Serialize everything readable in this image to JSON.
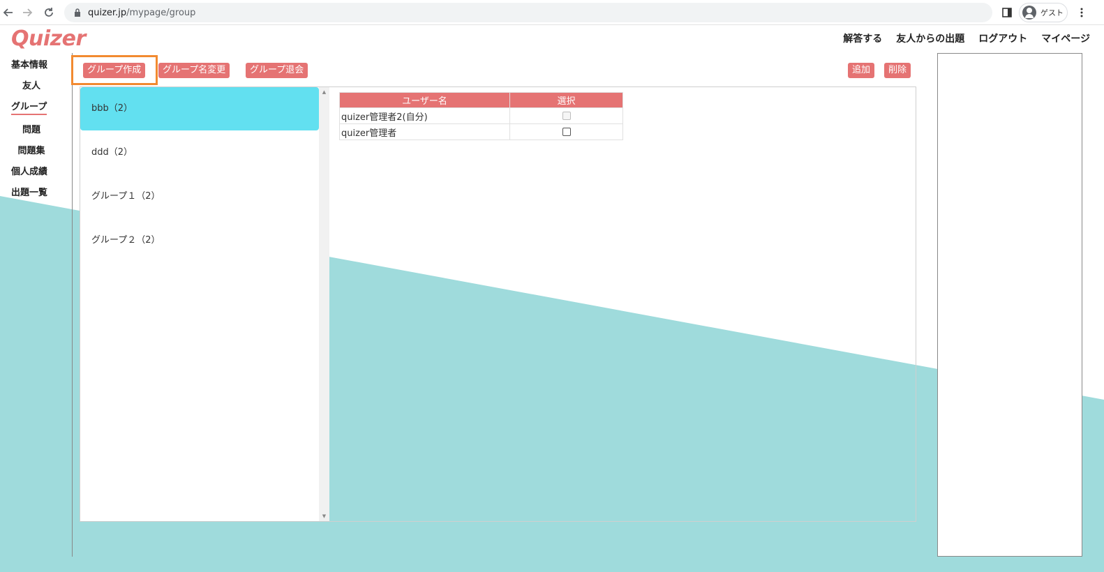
{
  "browser": {
    "url_domain": "quizer.jp",
    "url_path": "/mypage/group",
    "profile_label": "ゲスト",
    "icons": [
      "back-icon",
      "forward-icon",
      "reload-icon",
      "lock-icon",
      "side-panel-icon",
      "avatar-icon",
      "menu-dots-icon"
    ]
  },
  "app": {
    "logo": "Quizer",
    "brand_color": "#e57373",
    "accent_color": "#62e0f0",
    "background_shape_color": "#9fdbdc"
  },
  "topnav": {
    "answer": "解答する",
    "from_friends": "友人からの出題",
    "logout": "ログアウト",
    "mypage": "マイページ"
  },
  "sidebar": {
    "items": [
      {
        "label": "基本情報"
      },
      {
        "label": "友人"
      },
      {
        "label": "グループ",
        "active": true
      },
      {
        "label": "問題"
      },
      {
        "label": "問題集"
      },
      {
        "label": "個人成績"
      },
      {
        "label": "出題一覧"
      }
    ]
  },
  "toolbar": {
    "create": "グループ作成",
    "rename": "グループ名変更",
    "leave": "グループ退会",
    "add": "追加",
    "delete": "削除"
  },
  "groups": [
    {
      "label": "bbb（2）",
      "selected": true
    },
    {
      "label": "ddd（2）"
    },
    {
      "label": "グループ１（2）"
    },
    {
      "label": "グループ２（2）"
    }
  ],
  "members": {
    "headers": [
      "ユーザー名",
      "選択"
    ],
    "rows": [
      {
        "name": "quizer管理者2(自分)",
        "checkbox_disabled": true,
        "checked": false
      },
      {
        "name": "quizer管理者",
        "checkbox_disabled": false,
        "checked": false
      }
    ]
  }
}
